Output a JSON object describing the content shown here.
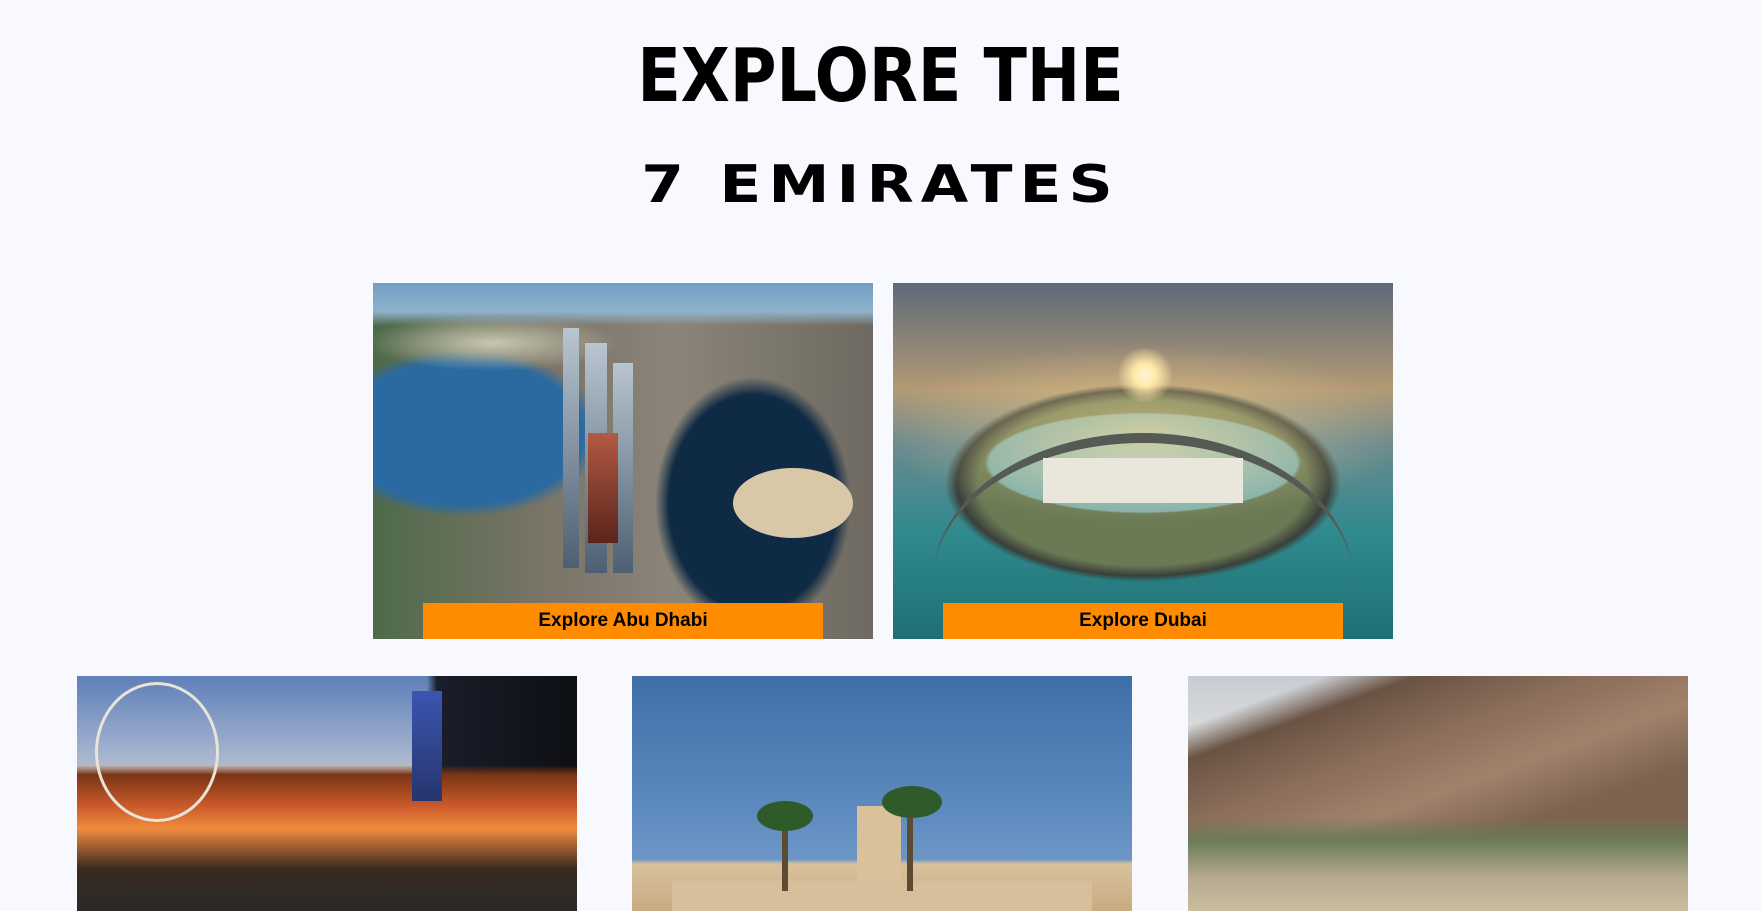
{
  "heading": {
    "line1": "EXPLORE THE",
    "line2": "7 EMIRATES"
  },
  "cards": [
    {
      "name": "Abu Dhabi",
      "button_label": "Explore Abu Dhabi"
    },
    {
      "name": "Dubai",
      "button_label": "Explore Dubai"
    }
  ],
  "accent_color": "#ff8c00",
  "background_color": "#f8f9fe"
}
